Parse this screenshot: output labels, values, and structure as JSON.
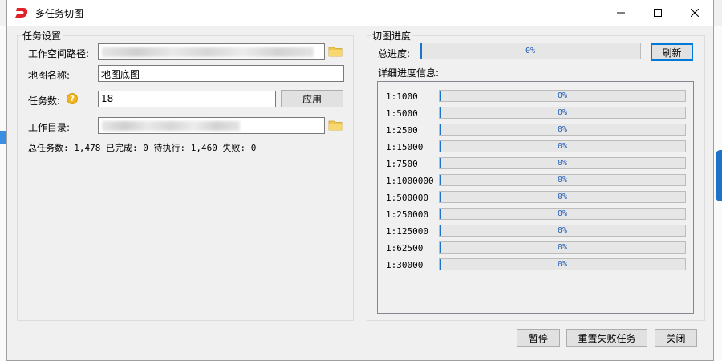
{
  "window": {
    "title": "多任务切图"
  },
  "task_settings": {
    "legend": "任务设置",
    "workspace_label": "工作空间路径:",
    "map_name_label": "地图名称:",
    "map_name_value": "地图底图",
    "task_count_label": "任务数:",
    "task_count_value": "18",
    "apply_label": "应用",
    "work_dir_label": "工作目录:",
    "summary": "总任务数: 1,478 已完成: 0 待执行: 1,460 失败: 0"
  },
  "progress": {
    "legend": "切图进度",
    "total_label": "总进度:",
    "total_percent": "0%",
    "total_value": 0,
    "refresh_label": "刷新",
    "detail_label": "详细进度信息:",
    "rows": [
      {
        "scale": "1:1000",
        "percent": "0%",
        "value": 0
      },
      {
        "scale": "1:5000",
        "percent": "0%",
        "value": 0
      },
      {
        "scale": "1:2500",
        "percent": "0%",
        "value": 0
      },
      {
        "scale": "1:15000",
        "percent": "0%",
        "value": 0
      },
      {
        "scale": "1:7500",
        "percent": "0%",
        "value": 0
      },
      {
        "scale": "1:1000000",
        "percent": "0%",
        "value": 0
      },
      {
        "scale": "1:500000",
        "percent": "0%",
        "value": 0
      },
      {
        "scale": "1:250000",
        "percent": "0%",
        "value": 0
      },
      {
        "scale": "1:125000",
        "percent": "0%",
        "value": 0
      },
      {
        "scale": "1:62500",
        "percent": "0%",
        "value": 0
      },
      {
        "scale": "1:30000",
        "percent": "0%",
        "value": 0
      }
    ]
  },
  "footer": {
    "pause_label": "暂停",
    "reset_failed_label": "重置失败任务",
    "close_label": "关闭"
  },
  "icons": {
    "app": "app-logo-icon",
    "minimize": "minimize-icon",
    "maximize": "maximize-icon",
    "close": "close-icon",
    "folder": "folder-icon",
    "help": "help-icon"
  },
  "colors": {
    "accent": "#0078d7",
    "progress_start": "#1e73c8",
    "progress_text": "#1e5bb5",
    "logo": "#e0202a",
    "help": "#f0b41e"
  }
}
